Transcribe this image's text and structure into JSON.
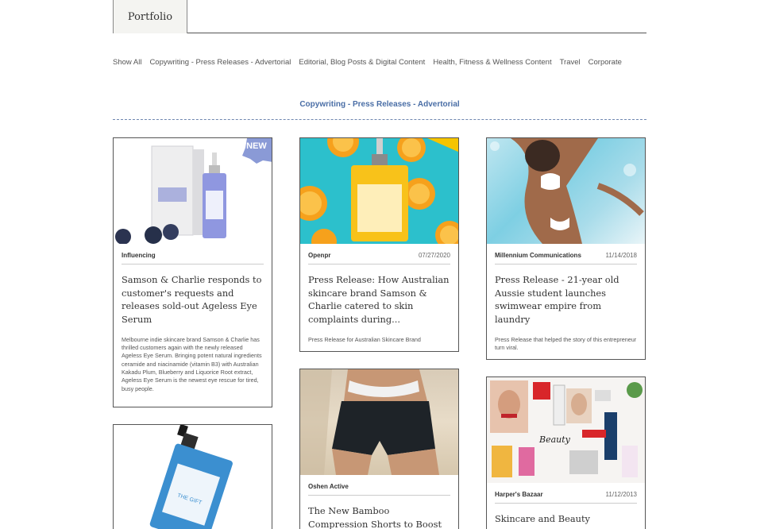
{
  "tab": {
    "label": "Portfolio"
  },
  "filters": [
    "Show All",
    "Copywriting - Press Releases - Advertorial",
    "Editorial, Blog Posts & Digital Content",
    "Health, Fitness & Wellness Content",
    "Travel",
    "Corporate"
  ],
  "section": {
    "title": "Copywriting - Press Releases - Advertorial"
  },
  "cards": [
    {
      "source": "Influencing",
      "date": "",
      "title": "Samson & Charlie responds to customer's requests and releases sold-out Ageless Eye Serum",
      "excerpt": "Melbourne indie skincare brand Samson & Charlie has thrilled customers again with the newly released Ageless Eye Serum. Bringing potent natural ingredients ceramide and niacinamide (vitamin B3) with Australian Kakadu Plum, Blueberry and Liquorice Root extract, Ageless Eye Serum is the newest eye rescue for tired, busy people.",
      "image_badge": "NEW",
      "image_label": "AGELESS EYE SERUM"
    },
    {
      "source": "Openpr",
      "date": "07/27/2020",
      "title": "Press Release: How Australian skincare brand Samson & Charlie catered to skin complaints during...",
      "excerpt": "Press Release for Australian Skincare Brand",
      "image_label": "VIBRANT C BRIGHTENING FACIAL OIL"
    },
    {
      "source": "Millennium Communications",
      "date": "11/14/2018",
      "title": "Press Release - 21-year old Aussie student launches swimwear empire from laundry",
      "excerpt": "Press Release that helped the story of this entrepreneur turn viral."
    },
    {
      "source": "Oshen Active",
      "date": "",
      "title": "The New Bamboo Compression Shorts to Boost",
      "excerpt": ""
    },
    {
      "source": "Harper's Bazaar",
      "date": "11/12/2013",
      "title": "Skincare and Beauty",
      "excerpt": "",
      "image_label": "Beauty"
    },
    {
      "source": "",
      "date": "",
      "title": "",
      "excerpt": "",
      "image_label": "THE GIFT"
    }
  ],
  "colors": {
    "accent": "#4a6ea6",
    "border": "#555555",
    "tab_bg": "#f4f4f1"
  }
}
